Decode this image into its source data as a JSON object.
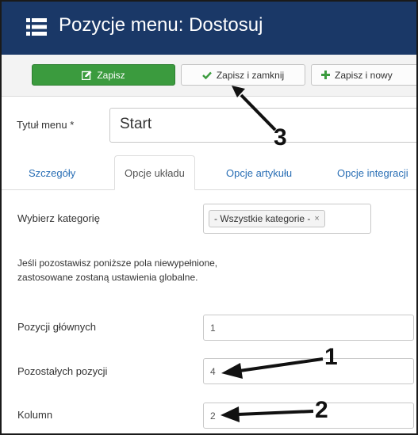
{
  "header": {
    "title": "Pozycje menu: Dostosuj",
    "background": "#1a3867",
    "icon": "list-icon"
  },
  "toolbar": {
    "save_label": "Zapisz",
    "save_icon": "edit-icon",
    "save_close_label": "Zapisz i zamknij",
    "save_close_icon": "check-icon",
    "save_new_label": "Zapisz i nowy",
    "save_new_icon": "plus-icon",
    "save_color": "#3b9b3e"
  },
  "form": {
    "title_label": "Tytuł menu *",
    "title_value": "Start"
  },
  "tabs": [
    {
      "label": "Szczegóły",
      "active": false
    },
    {
      "label": "Opcje układu",
      "active": true
    },
    {
      "label": "Opcje artykułu",
      "active": false
    },
    {
      "label": "Opcje integracji",
      "active": false
    }
  ],
  "layout": {
    "category_label": "Wybierz kategorię",
    "category_chip": "- Wszystkie kategorie -",
    "category_remove_glyph": "×",
    "info_line1": "Jeśli pozostawisz poniższe pola niewypełnione,",
    "info_line2": "zastosowane zostaną ustawienia globalne.",
    "leading_label": "Pozycji głównych",
    "leading_value": "1",
    "intro_label": "Pozostałych pozycji",
    "intro_value": "4",
    "columns_label": "Kolumn",
    "columns_value": "2"
  },
  "annotations": {
    "arrow_1_label": "1",
    "arrow_2_label": "2",
    "arrow_3_label": "3",
    "color": "#111111"
  }
}
